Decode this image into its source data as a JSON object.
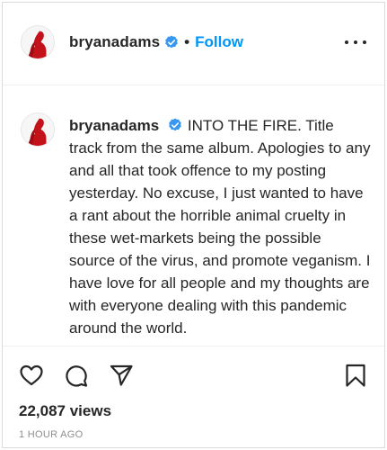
{
  "header": {
    "username": "bryanadams",
    "separator": "•",
    "follow_label": "Follow"
  },
  "caption": {
    "username": "bryanadams",
    "text": "INTO THE FIRE. Title track from the same album. Apologies to any and all that took offence to my posting yesterday. No excuse, I just wanted to have a rant about the horrible animal cruelty in these wet-markets being the possible source of the virus, and promote veganism. I have love for all people and my thoughts are with everyone dealing with this pandemic around the world."
  },
  "stats": {
    "views": "22,087 views",
    "timestamp": "1 HOUR AGO"
  },
  "icons": {
    "verified": "verified-badge-icon",
    "more": "more-options-icon",
    "like": "heart-icon",
    "comment": "comment-icon",
    "share": "share-icon",
    "save": "bookmark-icon"
  },
  "colors": {
    "accent": "#0095f6",
    "text": "#262626",
    "muted": "#8e8e8e",
    "avatar_figure": "#c4121a"
  }
}
